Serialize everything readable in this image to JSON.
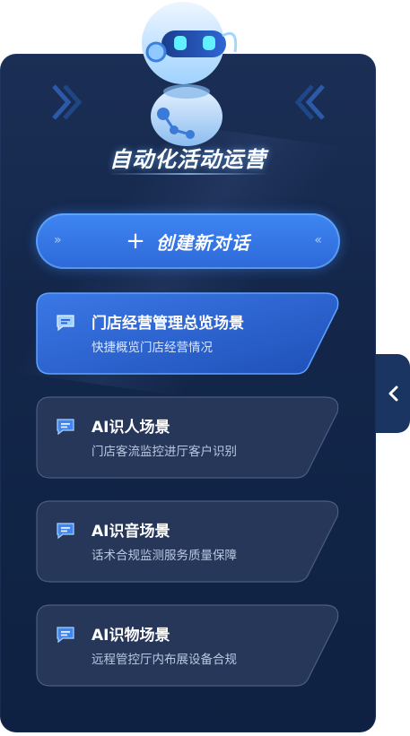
{
  "header": {
    "title": "自动化活动运营"
  },
  "new_chat": {
    "label": "创建新对话",
    "icon": "plus-icon"
  },
  "scenes": [
    {
      "title": "门店经营管理总览场景",
      "subtitle": "快捷概览门店经营情况",
      "active": true
    },
    {
      "title": "AI识人场景",
      "subtitle": "门店客流监控进厅客户识别",
      "active": false
    },
    {
      "title": "AI识音场景",
      "subtitle": "话术合规监测服务质量保障",
      "active": false
    },
    {
      "title": "AI识物场景",
      "subtitle": "远程管控厅内布展设备合规",
      "active": false
    }
  ],
  "collapse_tab": {
    "icon": "chevron-left-icon"
  },
  "colors": {
    "panel": "#14274b",
    "accent": "#2f6fe0",
    "active_card": "#2a5fc8",
    "inactive_card": "#2c3d60"
  }
}
